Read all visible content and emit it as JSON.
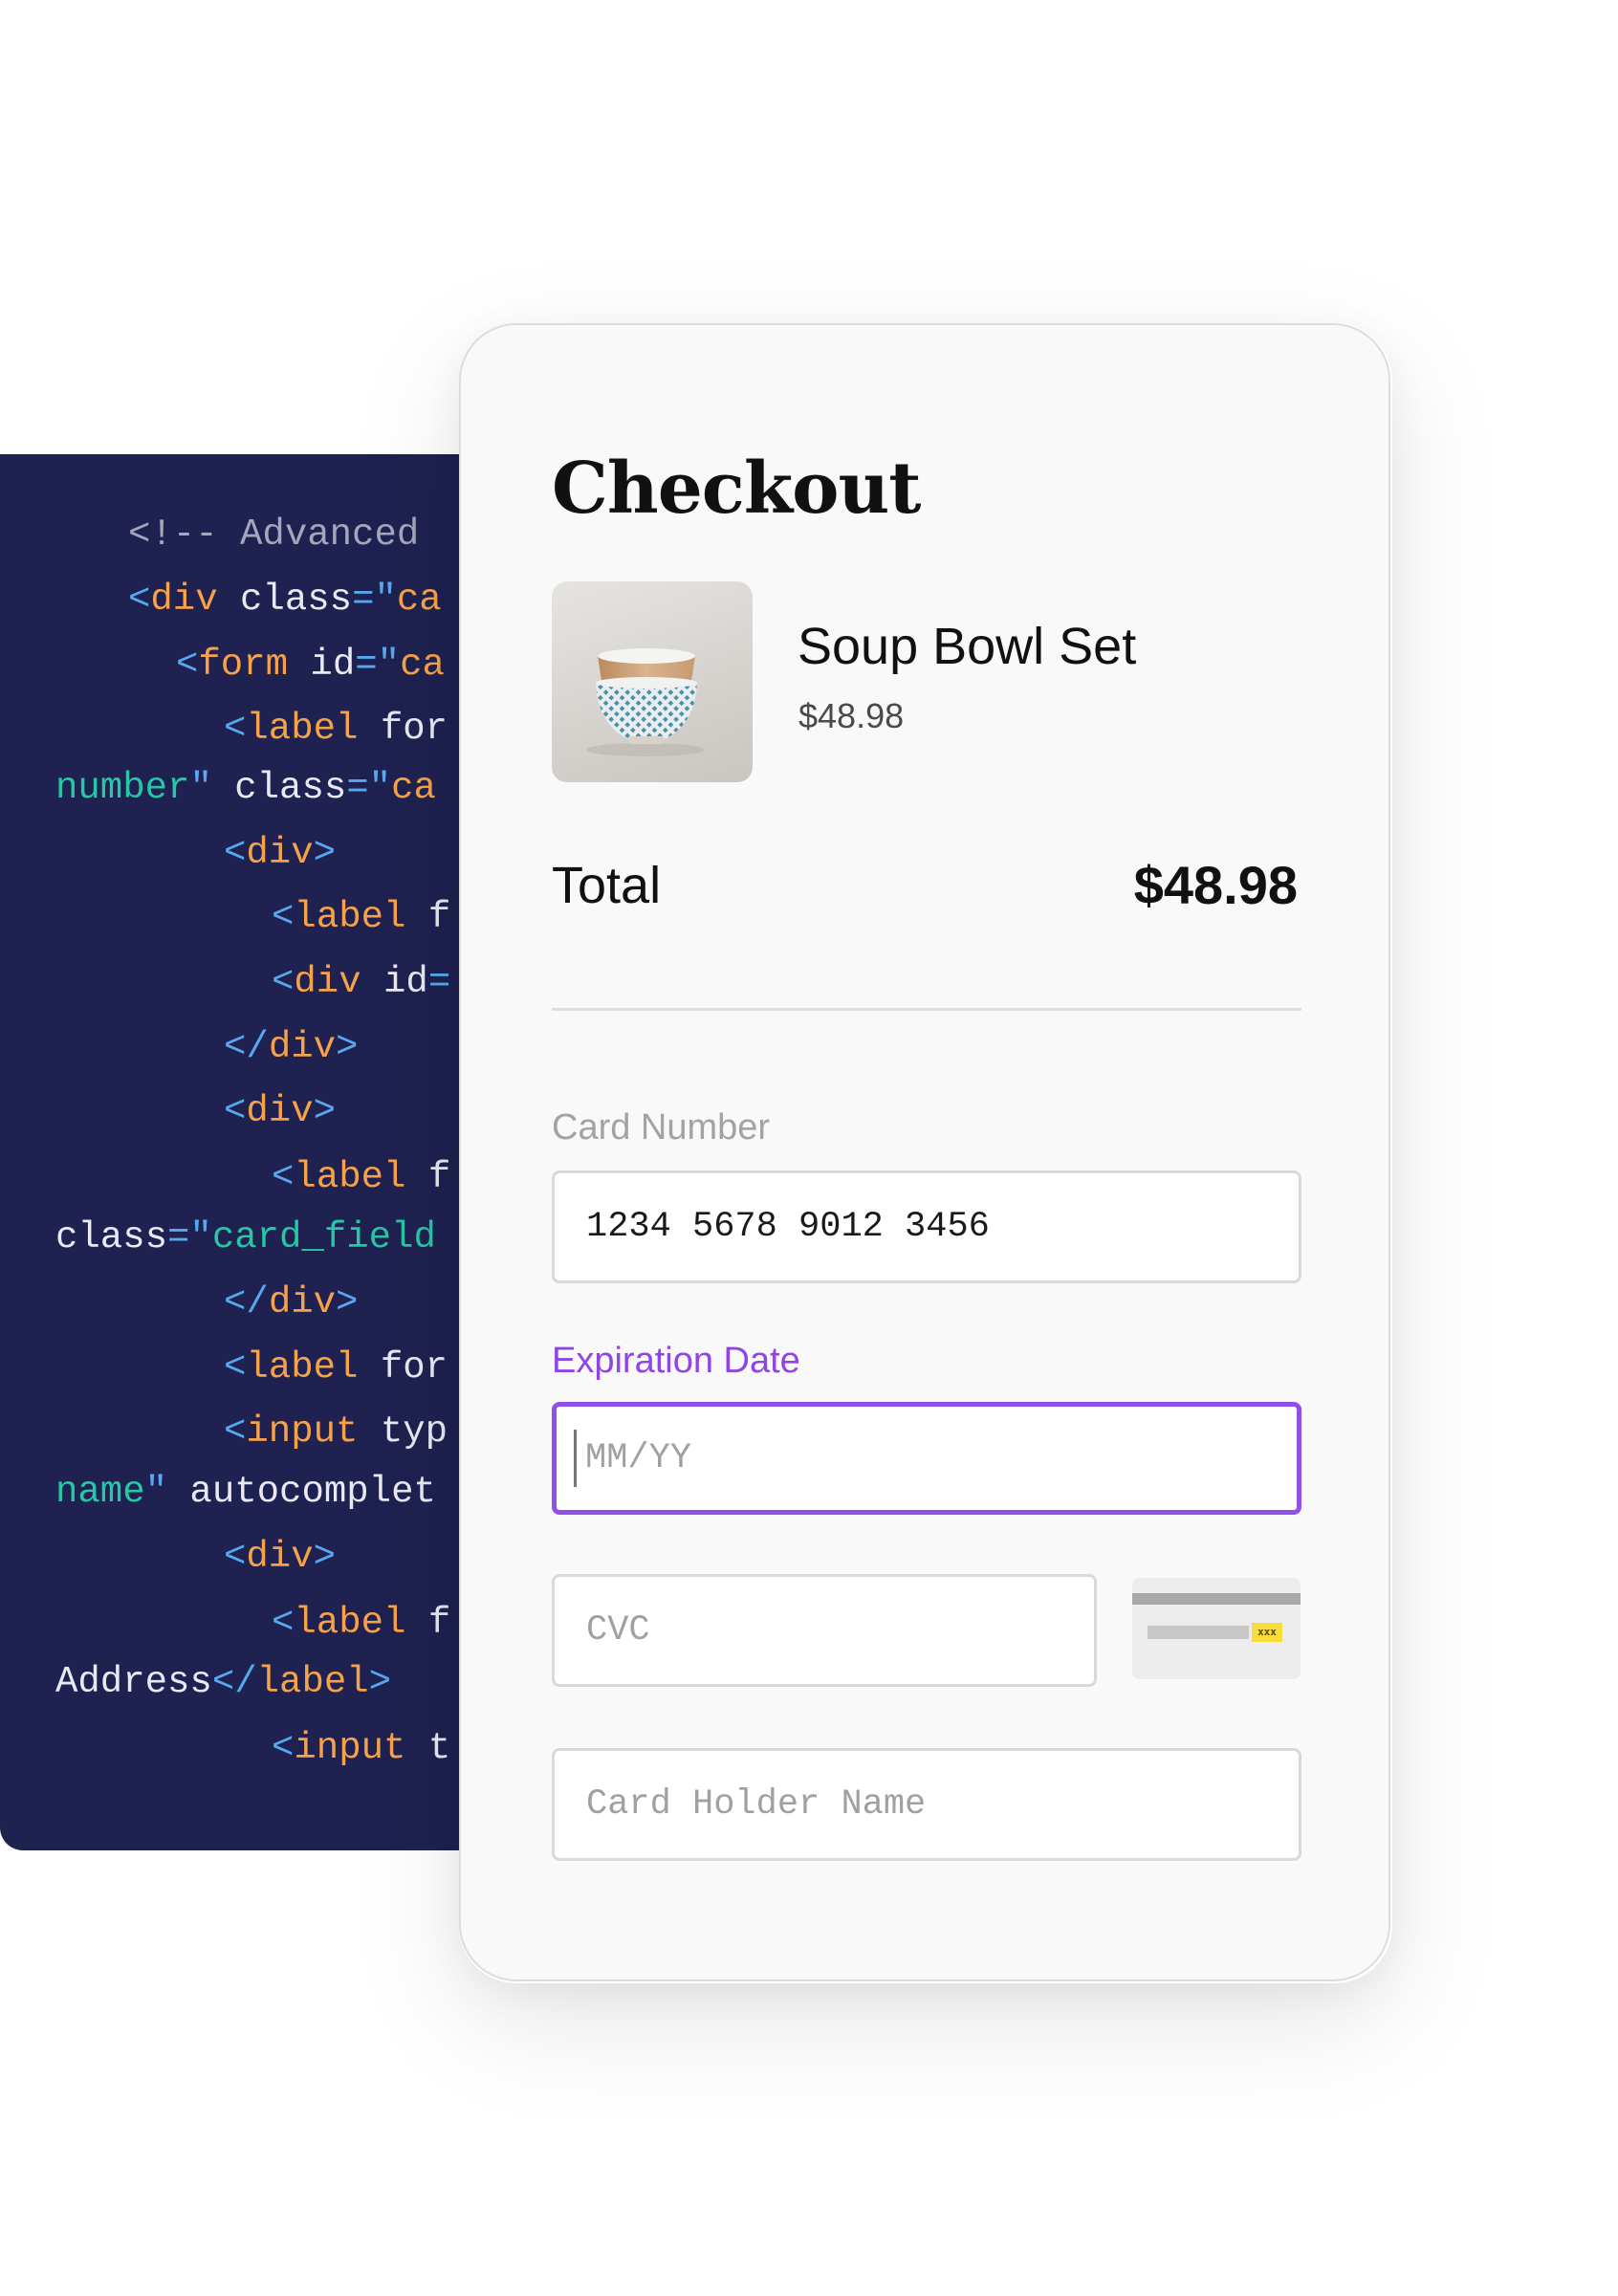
{
  "code_editor": {
    "lines": [
      [
        {
          "t": "<!-- Advanced ",
          "c": "comment"
        }
      ],
      [
        {
          "t": "<",
          "c": "punct"
        },
        {
          "t": "div",
          "c": "tag"
        },
        {
          "t": " class",
          "c": "attr"
        },
        {
          "t": "=\"",
          "c": "punct"
        },
        {
          "t": "ca",
          "c": "tag"
        }
      ],
      [
        {
          "t": "<",
          "c": "punct"
        },
        {
          "t": "form",
          "c": "tag"
        },
        {
          "t": " id",
          "c": "attr"
        },
        {
          "t": "=\"",
          "c": "punct"
        },
        {
          "t": "ca",
          "c": "tag"
        }
      ],
      [],
      [
        {
          "t": "<",
          "c": "punct"
        },
        {
          "t": "label",
          "c": "tag"
        },
        {
          "t": " for",
          "c": "attr"
        }
      ],
      [
        {
          "t": "number",
          "c": "str"
        },
        {
          "t": "\"",
          "c": "punct"
        },
        {
          "t": " class",
          "c": "attr"
        },
        {
          "t": "=\"",
          "c": "punct"
        },
        {
          "t": "ca",
          "c": "tag"
        }
      ],
      [
        {
          "t": "<",
          "c": "punct"
        },
        {
          "t": "div",
          "c": "tag"
        },
        {
          "t": ">",
          "c": "punct"
        }
      ],
      [
        {
          "t": "<",
          "c": "punct"
        },
        {
          "t": "label",
          "c": "tag"
        },
        {
          "t": " f",
          "c": "attr"
        }
      ],
      [
        {
          "t": "<",
          "c": "punct"
        },
        {
          "t": "div",
          "c": "tag"
        },
        {
          "t": " id",
          "c": "attr"
        },
        {
          "t": "=",
          "c": "punct"
        }
      ],
      [
        {
          "t": "</",
          "c": "punct"
        },
        {
          "t": "div",
          "c": "tag"
        },
        {
          "t": ">",
          "c": "punct"
        }
      ],
      [
        {
          "t": "<",
          "c": "punct"
        },
        {
          "t": "div",
          "c": "tag"
        },
        {
          "t": ">",
          "c": "punct"
        }
      ],
      [
        {
          "t": "<",
          "c": "punct"
        },
        {
          "t": "label",
          "c": "tag"
        },
        {
          "t": " f",
          "c": "attr"
        }
      ],
      [
        {
          "t": "class",
          "c": "attr"
        },
        {
          "t": "=\"",
          "c": "punct"
        },
        {
          "t": "card_field",
          "c": "str"
        }
      ],
      [
        {
          "t": "</",
          "c": "punct"
        },
        {
          "t": "div",
          "c": "tag"
        },
        {
          "t": ">",
          "c": "punct"
        }
      ],
      [
        {
          "t": "<",
          "c": "punct"
        },
        {
          "t": "label",
          "c": "tag"
        },
        {
          "t": " for",
          "c": "attr"
        }
      ],
      [
        {
          "t": "<",
          "c": "punct"
        },
        {
          "t": "input",
          "c": "tag"
        },
        {
          "t": " typ",
          "c": "attr"
        }
      ],
      [
        {
          "t": "name",
          "c": "str"
        },
        {
          "t": "\"",
          "c": "punct"
        },
        {
          "t": " autocomplet",
          "c": "attr"
        }
      ],
      [
        {
          "t": "<",
          "c": "punct"
        },
        {
          "t": "div",
          "c": "tag"
        },
        {
          "t": ">",
          "c": "punct"
        }
      ],
      [
        {
          "t": "<",
          "c": "punct"
        },
        {
          "t": "label",
          "c": "tag"
        },
        {
          "t": " f",
          "c": "attr"
        }
      ],
      [
        {
          "t": "Address",
          "c": "text"
        },
        {
          "t": "</",
          "c": "punct"
        },
        {
          "t": "label",
          "c": "tag"
        },
        {
          "t": ">",
          "c": "punct"
        }
      ],
      [
        {
          "t": "<",
          "c": "punct"
        },
        {
          "t": "input",
          "c": "tag"
        },
        {
          "t": " t",
          "c": "attr"
        }
      ]
    ]
  },
  "checkout": {
    "title": "Checkout",
    "product": {
      "name": "Soup Bowl Set",
      "price": "$48.98"
    },
    "total": {
      "label": "Total",
      "value": "$48.98"
    },
    "fields": {
      "card_number": {
        "label": "Card Number",
        "value": "1234 5678 9012 3456"
      },
      "expiration": {
        "label": "Expiration Date",
        "placeholder": "MM/YY"
      },
      "cvc": {
        "placeholder": "CVC",
        "hint_code": "xxx"
      },
      "holder": {
        "placeholder": "Card Holder Name"
      }
    },
    "colors": {
      "accent": "#8f45e6",
      "code_background": "#1f2150"
    }
  }
}
